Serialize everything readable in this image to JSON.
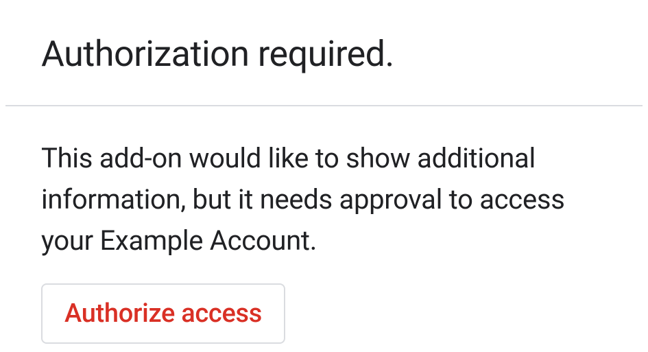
{
  "header": {
    "title": "Authorization required."
  },
  "body": {
    "description": "This add-on would like to show additional information, but it needs approval to access your Example Account.",
    "authorize_label": "Authorize access"
  }
}
